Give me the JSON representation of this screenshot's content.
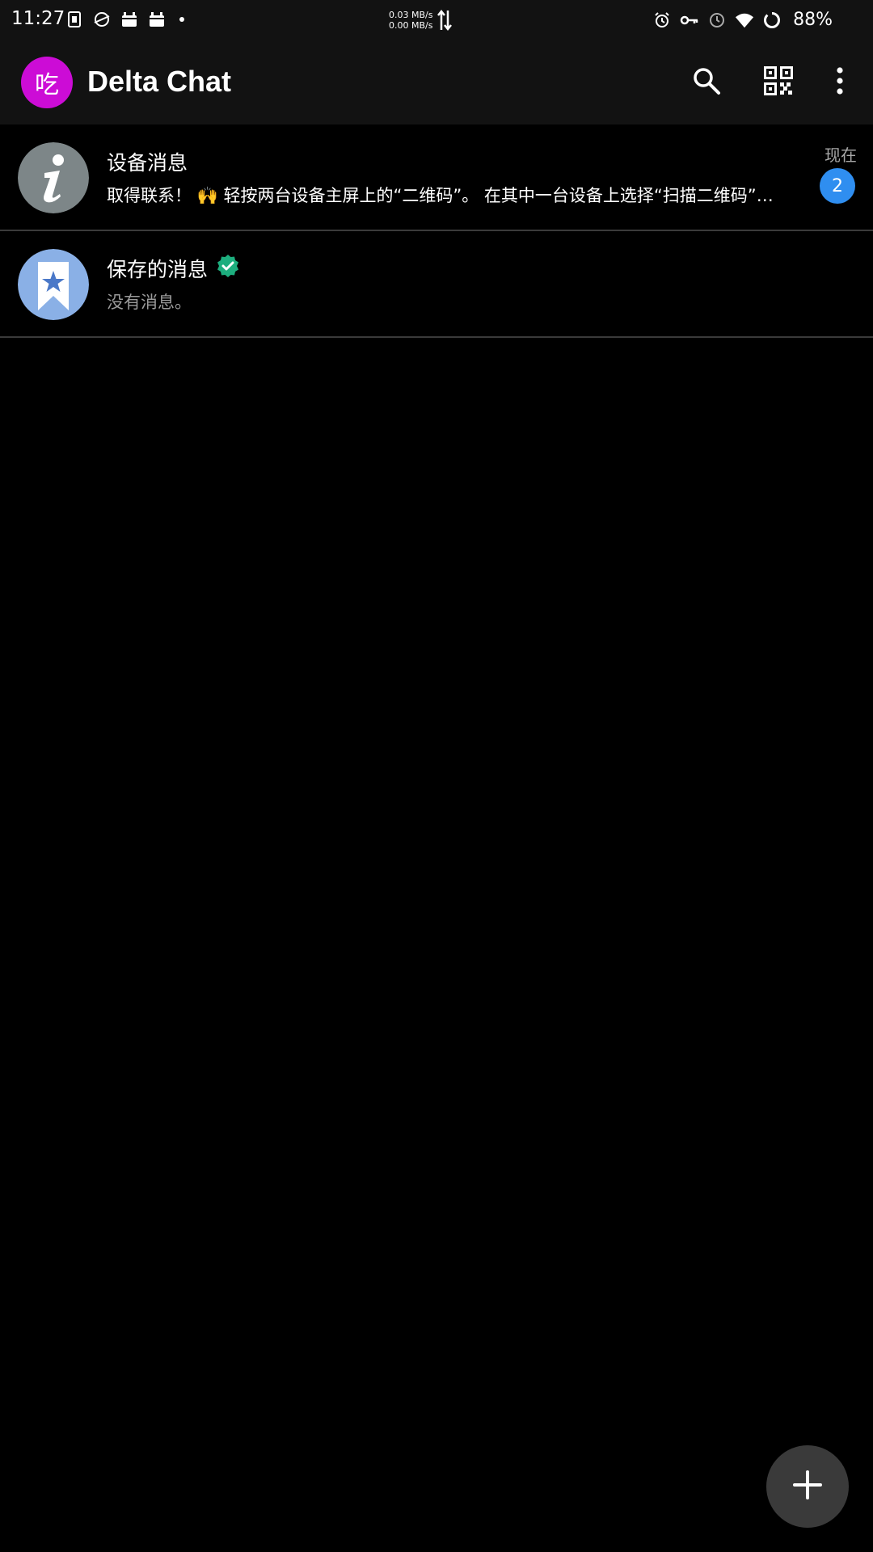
{
  "status_bar": {
    "time": "11:27",
    "net_up": "0.03 MB/s",
    "net_down": "0.00 MB/s",
    "battery": "88%",
    "left_icons": [
      "sim-card-icon",
      "browser-icon",
      "android-icon",
      "android-icon",
      "dot-icon"
    ],
    "right_icons": [
      "alarm-icon",
      "vpn-key-icon",
      "clock-icon",
      "wifi-icon",
      "battery-ring-icon"
    ]
  },
  "app_bar": {
    "avatar_letter": "吃",
    "avatar_color": "#cc0cd6",
    "title": "Delta Chat",
    "actions": [
      "search-icon",
      "qr-code-icon",
      "more-vert-icon"
    ]
  },
  "chats": [
    {
      "title": "设备消息",
      "snippet": "取得联系！ 🙌 轻按两台设备主屏上的“二维码”。 在其中一台设备上选择“扫描二维码”…",
      "time": "现在",
      "unread": "2",
      "avatar_icon": "info-icon",
      "avatar_color": "#7d8688"
    },
    {
      "title": "保存的消息",
      "snippet": "没有消息。",
      "verified": true,
      "avatar_icon": "bookmark-star-icon",
      "avatar_color": "#8ab0e6"
    }
  ],
  "fab": {
    "icon": "plus-icon"
  },
  "colors": {
    "badge": "#2f8ef0",
    "verified": "#1dae7e",
    "background": "#000000",
    "bar": "#121212"
  }
}
